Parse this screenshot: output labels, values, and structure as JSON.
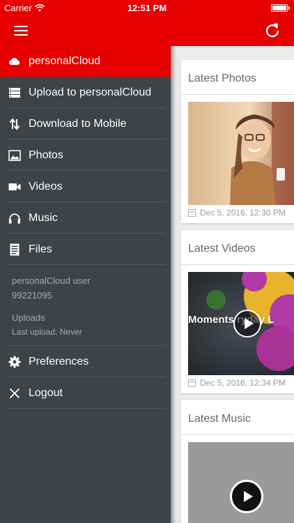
{
  "status_bar": {
    "carrier": "Carrier",
    "time": "12:51 PM",
    "battery_level": 1.0
  },
  "app_bar": {
    "menu_icon": "hamburger-icon",
    "refresh_icon": "refresh-icon"
  },
  "drawer": {
    "header": {
      "label": "personalCloud",
      "icon": "cloud-icon"
    },
    "items": [
      {
        "label": "Upload to personalCloud",
        "icon": "storage-upload-icon"
      },
      {
        "label": "Download to Mobile",
        "icon": "up-down-arrows-icon"
      },
      {
        "label": "Photos",
        "icon": "image-icon"
      },
      {
        "label": "Videos",
        "icon": "video-camera-icon"
      },
      {
        "label": "Music",
        "icon": "headphones-icon"
      },
      {
        "label": "Files",
        "icon": "document-icon"
      }
    ],
    "user": {
      "name": "personalCloud user",
      "phone": "99221095",
      "uploads_label": "Uploads",
      "last_upload": "Last upload: Never"
    },
    "footer_items": [
      {
        "label": "Preferences",
        "icon": "gear-icon"
      },
      {
        "label": "Logout",
        "icon": "close-icon"
      }
    ]
  },
  "content": {
    "cards": [
      {
        "title": "Latest Photos",
        "date": "Dec 5, 2016, 12:30 PM"
      },
      {
        "title": "Latest Videos",
        "date": "Dec 5, 2016, 12:34 PM",
        "video_caption": "Moments    ryday L"
      },
      {
        "title": "Latest Music"
      }
    ]
  },
  "colors": {
    "brand_red": "#e60000",
    "drawer_bg": "#3e4345",
    "content_bg": "#ebebeb"
  }
}
